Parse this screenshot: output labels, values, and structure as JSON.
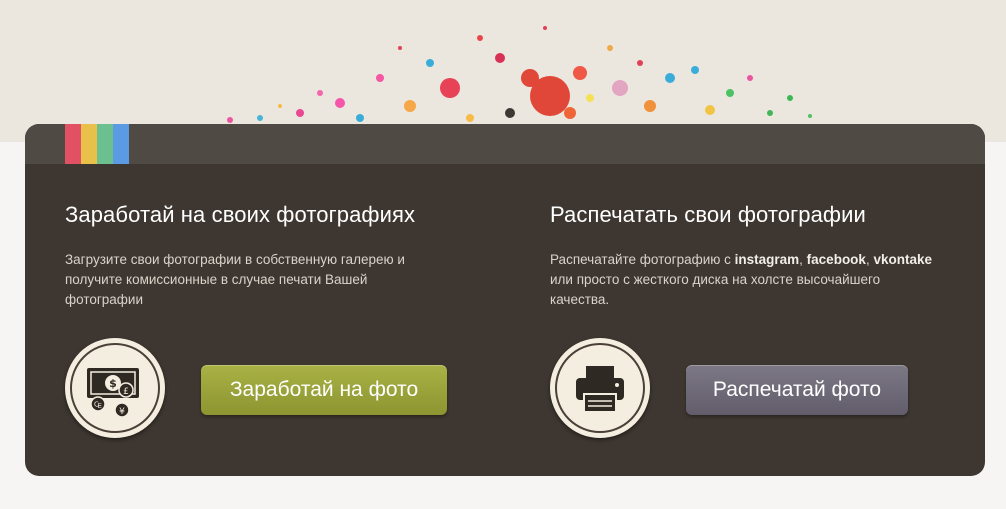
{
  "colors": {
    "page_bg": "#f6f5f3",
    "top_band": "#ebe7df",
    "card_bg": "#3e3731",
    "card_header": "#4f4a44",
    "stripes": [
      "#e25063",
      "#e8c04a",
      "#6cc08f",
      "#5b9be3"
    ],
    "earn_button": "#9aa33a",
    "print_button": "#6f6a78"
  },
  "left": {
    "title": "Заработай на своих фотографиях",
    "desc_line1": "Загрузите свои фотографии в собственную галерею и",
    "desc_line2": "получите комиссионные в случае печати Вашей",
    "desc_line3": "фотографии",
    "icon": "money-exchange-icon",
    "button": "Заработай на фото"
  },
  "right": {
    "title": "Распечатать свои фотографии",
    "desc_prefix": "Распечатайте фотографию с ",
    "instagram": "instagram",
    "comma1": ", ",
    "facebook": "facebook",
    "comma2": ", ",
    "vkontake": "vkontake",
    "desc_line2": "или просто с жесткого диска на холсте высочайшего",
    "desc_line3": "качества.",
    "icon": "printer-icon",
    "button": "Распечатай фото"
  }
}
